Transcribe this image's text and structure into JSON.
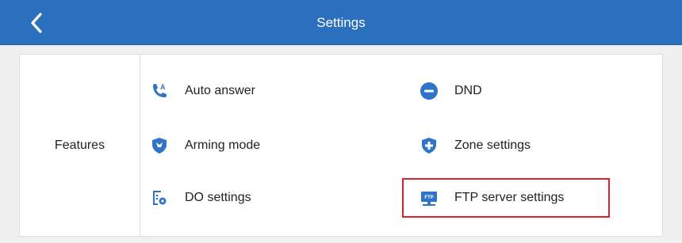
{
  "header": {
    "title": "Settings",
    "back_icon": "chevron-left-icon",
    "bg_color": "#2b6fbf"
  },
  "section": {
    "label": "Features"
  },
  "items": [
    {
      "label": "Auto answer",
      "icon": "auto-answer-phone-icon"
    },
    {
      "label": "DND",
      "icon": "dnd-minus-circle-icon"
    },
    {
      "label": "Arming mode",
      "icon": "arming-shield-icon"
    },
    {
      "label": "Zone settings",
      "icon": "zone-shield-plus-icon"
    },
    {
      "label": "DO settings",
      "icon": "do-settings-icon"
    },
    {
      "label": "FTP server settings",
      "icon": "ftp-monitor-icon"
    }
  ],
  "colors": {
    "accent": "#2b6fbf",
    "highlight": "#e01f26",
    "icon_blue": "#2f74c8"
  }
}
